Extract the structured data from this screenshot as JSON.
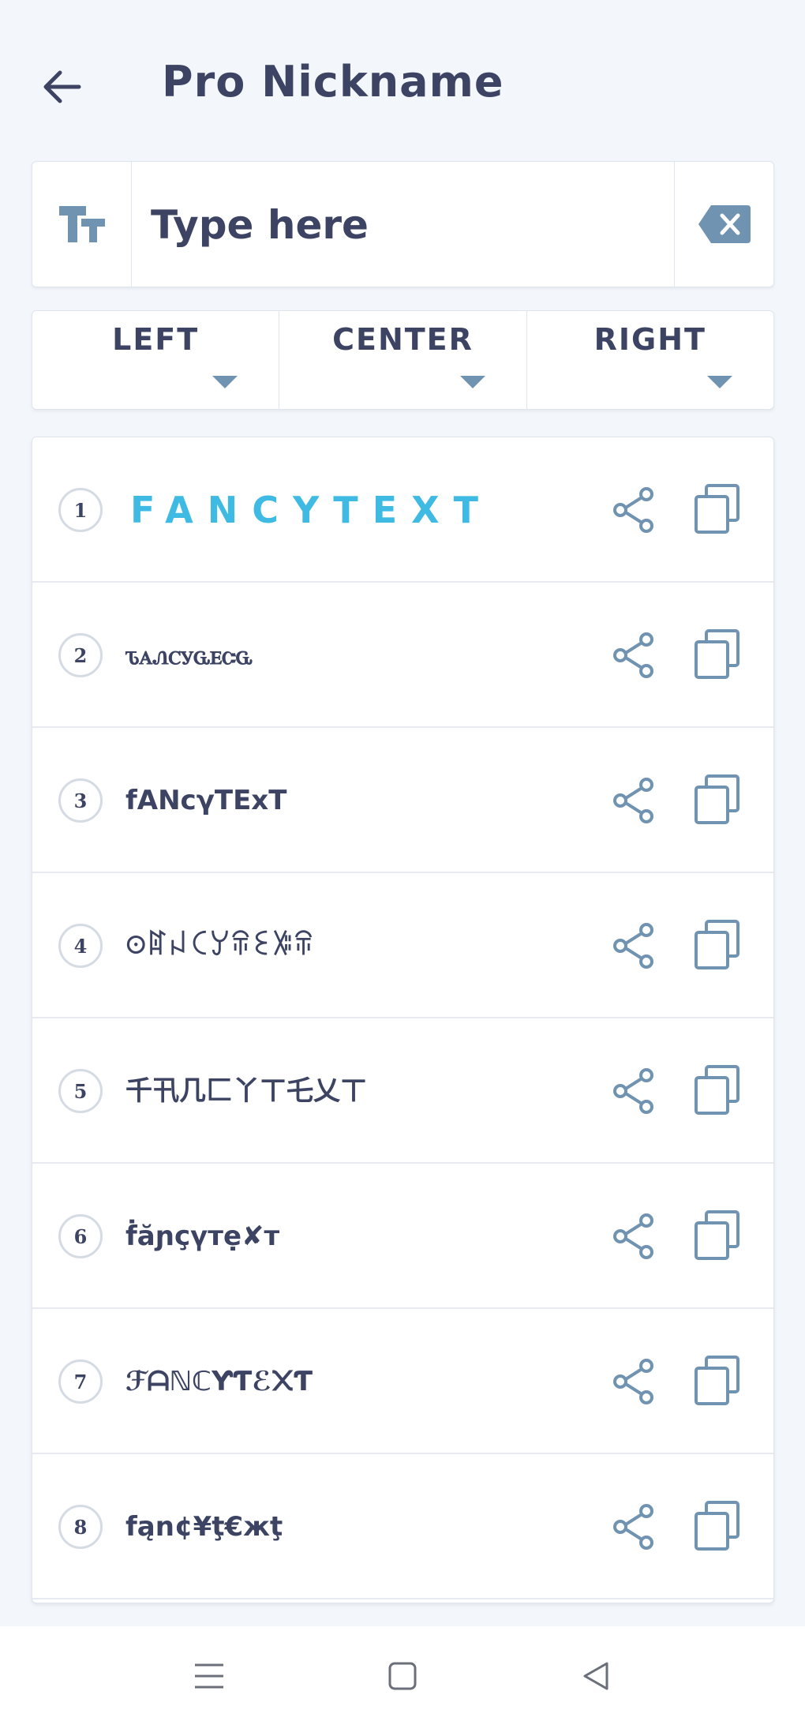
{
  "header": {
    "title": "Pro Nickname"
  },
  "input": {
    "placeholder": "Type here",
    "value": ""
  },
  "alignment": {
    "options": [
      {
        "label": "LEFT"
      },
      {
        "label": "CENTER"
      },
      {
        "label": "RIGHT"
      }
    ]
  },
  "results": [
    {
      "number": "1",
      "text": "FANCYTEXT"
    },
    {
      "number": "2",
      "text": "ꮦꭺꮑꮯꭹꮹꭼꮸꮹ"
    },
    {
      "number": "3",
      "text": "fANcγTExT"
    },
    {
      "number": "4",
      "text": "ꖴꍏꈤꉔꌦꋖꏂꋚꋖ"
    },
    {
      "number": "5",
      "text": "千卂几匚丫ㄒ乇乂ㄒ"
    },
    {
      "number": "6",
      "text": "ḟăɲçүтẹ✘т"
    },
    {
      "number": "7",
      "text": "ℱᗩℕℂƳƬℰ᙭Ƭ"
    },
    {
      "number": "8",
      "text": "fąn¢¥ţ€жţ"
    }
  ],
  "colors": {
    "accent": "#3fbbe3",
    "icon": "#6f93b1",
    "text": "#3d4463",
    "background": "#f3f7fc"
  },
  "icons": {
    "back": "arrow-left-icon",
    "text_size": "text-size-icon",
    "clear": "backspace-clear-icon",
    "share": "share-icon",
    "copy": "copy-icon",
    "nav_menu": "menu-icon",
    "nav_home": "home-square-icon",
    "nav_back": "back-triangle-icon"
  }
}
